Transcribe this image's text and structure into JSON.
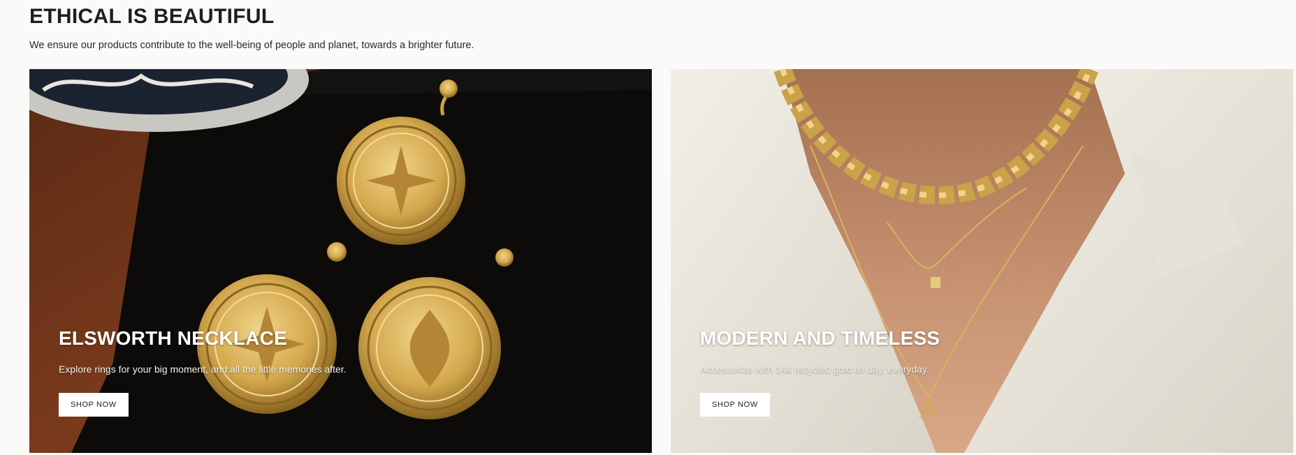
{
  "section": {
    "title": "ETHICAL IS BEAUTIFUL",
    "subtitle": "We ensure our products contribute to the well-being of people and planet, towards a brighter future."
  },
  "cards": [
    {
      "title": "ELSWORTH NECKLACE",
      "description": "Explore rings for your big moment, and all the little memories after.",
      "button_label": "SHOP NOW",
      "image": "gold-coin-earrings-photo"
    },
    {
      "title": "MODERN AND TIMELESS",
      "description": "Accessorize with 14k recycled gold all day, everyday.",
      "button_label": "SHOP NOW",
      "image": "gold-chain-necklaces-photo"
    }
  ],
  "colors": {
    "page_background": "#fbfaf8",
    "heading_text": "#1e1e1e",
    "gold": "#c9a24a",
    "button_background": "#ffffff"
  }
}
